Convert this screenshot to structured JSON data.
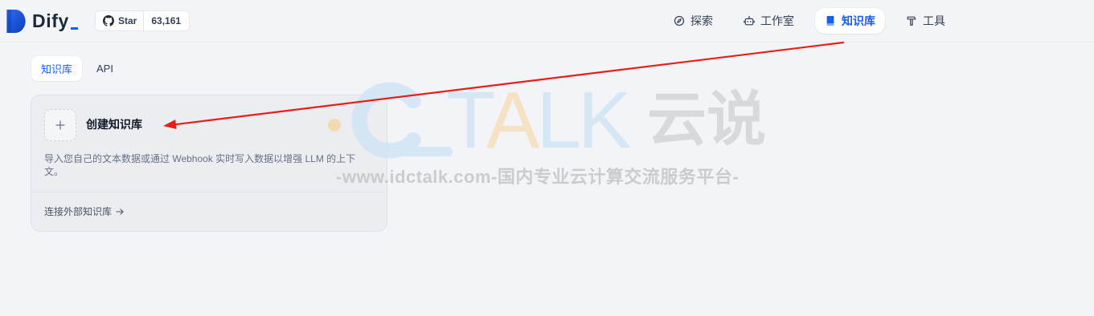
{
  "colors": {
    "accent": "#155eef",
    "page_bg": "#f2f4f7"
  },
  "app": {
    "logo_text": "Dify",
    "logo_icon": "dify-logo-icon"
  },
  "github": {
    "icon": "github-icon",
    "star_label": "Star",
    "star_count": "63,161"
  },
  "nav": {
    "items": [
      {
        "label": "探索",
        "icon": "compass-icon",
        "active": false
      },
      {
        "label": "工作室",
        "icon": "robot-icon",
        "active": false
      },
      {
        "label": "知识库",
        "icon": "book-icon",
        "active": true
      },
      {
        "label": "工具",
        "icon": "hammer-icon",
        "active": false
      }
    ]
  },
  "tabs": [
    {
      "label": "知识库",
      "active": true
    },
    {
      "label": "API",
      "active": false
    }
  ],
  "create_card": {
    "icon": "plus-icon",
    "title": "创建知识库",
    "description": "导入您自己的文本数据或通过 Webhook 实时写入数据以增强 LLM 的上下文。",
    "external_link": "连接外部知识库",
    "external_link_icon": "arrow-right-icon"
  },
  "annotation": {
    "type": "arrow",
    "color": "#e4201b"
  },
  "watermark": {
    "letters": [
      "T",
      "A",
      "L",
      "K"
    ],
    "brand_cn": "云说",
    "tagline": "-www.idctalk.com-国内专业云计算交流服务平台-"
  }
}
